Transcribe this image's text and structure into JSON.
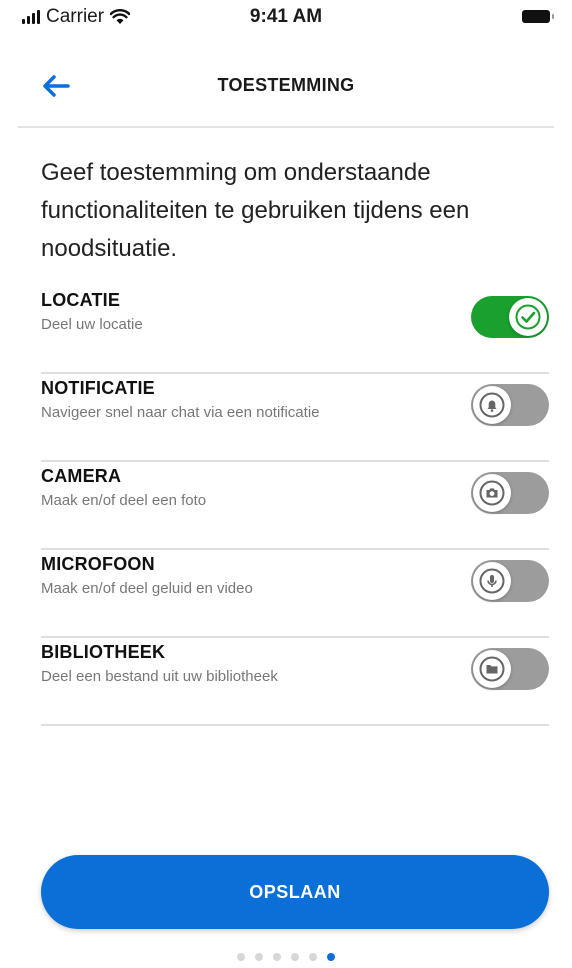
{
  "status_bar": {
    "carrier": "Carrier",
    "time": "9:41 AM"
  },
  "header": {
    "title": "TOESTEMMING"
  },
  "intro": "Geef toestemming om onderstaande functionaliteiten te gebruiken tijdens een noodsituatie.",
  "permissions": [
    {
      "title": "LOCATIE",
      "description": "Deel uw locatie",
      "enabled": true,
      "icon": "check-icon"
    },
    {
      "title": "NOTIFICATIE",
      "description": "Navigeer snel naar chat via een notificatie",
      "enabled": false,
      "icon": "bell-icon"
    },
    {
      "title": "CAMERA",
      "description": "Maak en/of deel een foto",
      "enabled": false,
      "icon": "camera-icon"
    },
    {
      "title": "MICROFOON",
      "description": "Maak en/of deel geluid en video",
      "enabled": false,
      "icon": "microphone-icon"
    },
    {
      "title": "BIBLIOTHEEK",
      "description": "Deel een bestand uit uw bibliotheek",
      "enabled": false,
      "icon": "folder-icon"
    }
  ],
  "save_button": {
    "label": "OPSLAAN"
  },
  "pagination": {
    "total": 6,
    "current": 6
  },
  "colors": {
    "accent": "#0a6fd6",
    "toggle_on": "#1aa02e",
    "toggle_off": "#9c9c9c"
  }
}
